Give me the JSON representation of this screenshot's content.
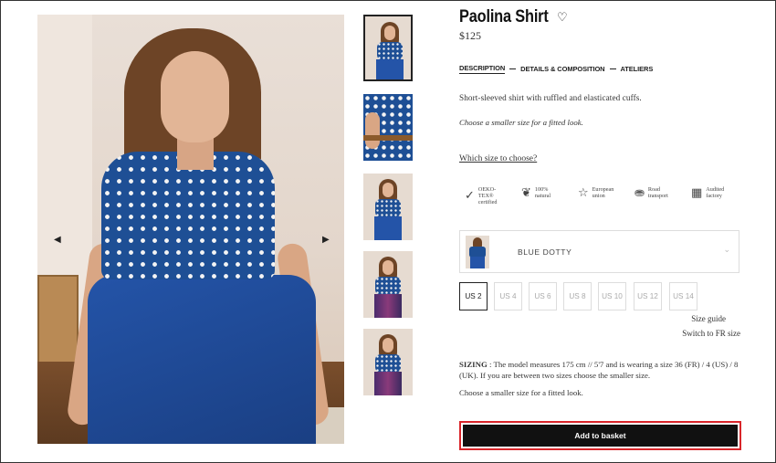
{
  "product": {
    "title": "Paolina Shirt",
    "price": "$125",
    "tabs": [
      "DESCRIPTION",
      "DETAILS & COMPOSITION",
      "ATELIERS"
    ],
    "description": "Short-sleeved shirt with ruffled and elasticated cuffs.",
    "description_italic": "Choose a smaller size for a fitted look.",
    "which_size_link": "Which size to choose?",
    "badges": [
      {
        "icon": "oekotex-icon",
        "line1": "OEKO-",
        "line2": "TEX®",
        "line3": "certified"
      },
      {
        "icon": "leaf-icon",
        "line1": "100%",
        "line2": "natural",
        "line3": ""
      },
      {
        "icon": "europe-icon",
        "line1": "European",
        "line2": "union",
        "line3": ""
      },
      {
        "icon": "truck-icon",
        "line1": "Road",
        "line2": "transport",
        "line3": ""
      },
      {
        "icon": "factory-icon",
        "line1": "Audited",
        "line2": "factory",
        "line3": ""
      }
    ],
    "color_selected": "BLUE DOTTY",
    "sizes": [
      "US 2",
      "US 4",
      "US 6",
      "US 8",
      "US 10",
      "US 12",
      "US 14"
    ],
    "selected_size": "US 2",
    "size_guide": "Size guide",
    "switch_size": "Switch to FR size",
    "sizing_label": "SIZING",
    "sizing_text": " : The model measures 175 cm // 5'7 and is wearing a size 36 (FR) / 4 (US) / 8 (UK). If you are between two sizes choose the smaller size.",
    "choose_text": "Choose a smaller size for a fitted look.",
    "add_to_basket": "Add to basket"
  },
  "gallery": {
    "prev_icon": "chevron-left-icon",
    "next_icon": "chevron-right-icon",
    "thumbnail_count": 5,
    "active_thumbnail": 1
  },
  "colors": {
    "accent_border": "#d9252a",
    "button_bg": "#111111",
    "shirt_blue": "#1e4f95"
  }
}
